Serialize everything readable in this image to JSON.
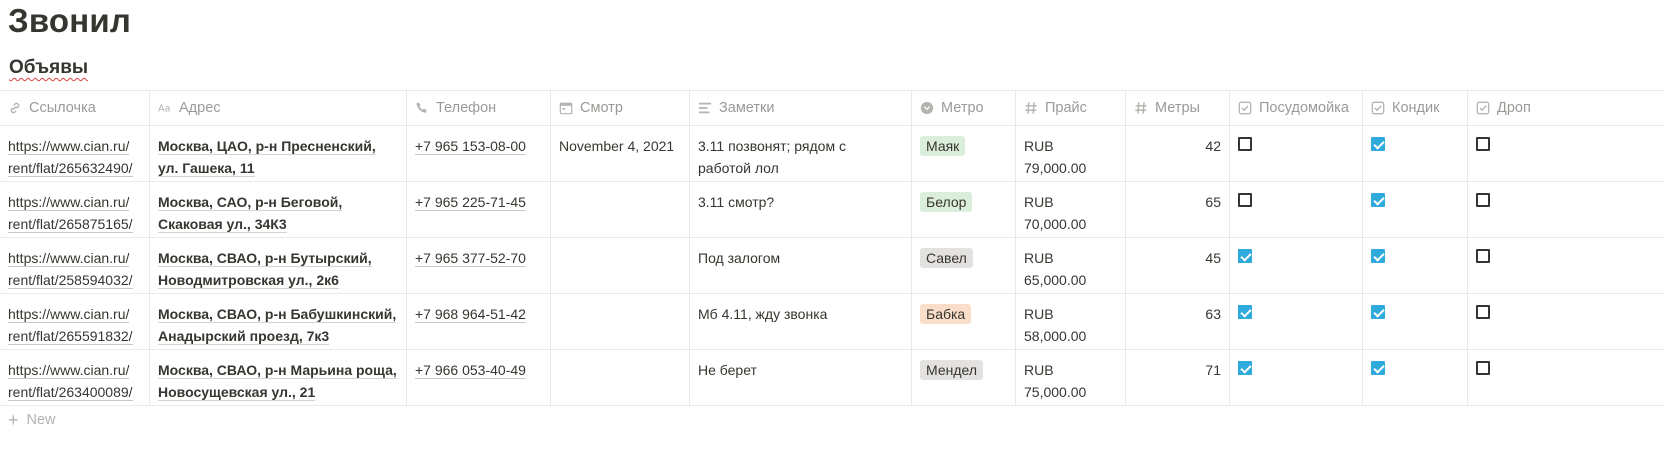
{
  "page": {
    "title": "Звонил",
    "view_name": "Объявы"
  },
  "columns": [
    {
      "key": "link",
      "label": "Ссылочка",
      "icon": "link-icon"
    },
    {
      "key": "address",
      "label": "Адрес",
      "icon": "text-icon"
    },
    {
      "key": "phone",
      "label": "Телефон",
      "icon": "phone-icon"
    },
    {
      "key": "viewing",
      "label": "Смотр",
      "icon": "calendar-icon"
    },
    {
      "key": "notes",
      "label": "Заметки",
      "icon": "lines-icon"
    },
    {
      "key": "metro",
      "label": "Метро",
      "icon": "select-icon"
    },
    {
      "key": "price",
      "label": "Прайс",
      "icon": "hash-icon"
    },
    {
      "key": "meters",
      "label": "Метры",
      "icon": "hash-icon"
    },
    {
      "key": "dishwasher",
      "label": "Посудомойка",
      "icon": "checkbox-icon"
    },
    {
      "key": "ac",
      "label": "Кондик",
      "icon": "checkbox-icon"
    },
    {
      "key": "drop",
      "label": "Дроп",
      "icon": "checkbox-icon"
    }
  ],
  "rows": [
    {
      "link_l1": "https://www.cian.ru/",
      "link_l2": "rent/flat/265632490/",
      "addr_l1": "Москва, ЦАО, р-н Пресненский,",
      "addr_l2": "ул. Гашека, 11",
      "phone": "+7 965 153-08-00",
      "viewing": "November 4, 2021",
      "notes_l1": "3.11 позвонят; рядом с",
      "notes_l2": "работой лол",
      "metro": "Маяк",
      "metro_color": "#dbeddb",
      "price": "RUB 79,000.00",
      "meters": "42",
      "dishwasher": false,
      "ac": true,
      "drop": false
    },
    {
      "link_l1": "https://www.cian.ru/",
      "link_l2": "rent/flat/265875165/",
      "addr_l1": "Москва, САО, р-н Беговой,",
      "addr_l2": "Скаковая ул., 34К3",
      "phone": "+7 965 225-71-45",
      "viewing": "",
      "notes_l1": "3.11 смотр?",
      "notes_l2": "",
      "metro": "Белор",
      "metro_color": "#dbeddb",
      "price": "RUB 70,000.00",
      "meters": "65",
      "dishwasher": false,
      "ac": true,
      "drop": false
    },
    {
      "link_l1": "https://www.cian.ru/",
      "link_l2": "rent/flat/258594032/",
      "addr_l1": "Москва, СВАО, р-н Бутырский,",
      "addr_l2": "Новодмитровская ул., 2к6",
      "phone": "+7 965 377-52-70",
      "viewing": "",
      "notes_l1": "Под залогом",
      "notes_l2": "",
      "metro": "Савел",
      "metro_color": "#e3e2e0",
      "price": "RUB 65,000.00",
      "meters": "45",
      "dishwasher": true,
      "ac": true,
      "drop": false
    },
    {
      "link_l1": "https://www.cian.ru/",
      "link_l2": "rent/flat/265591832/",
      "addr_l1": "Москва, СВАО, р-н Бабушкинский,",
      "addr_l2": "Анадырский проезд, 7к3",
      "phone": "+7 968 964-51-42",
      "viewing": "",
      "notes_l1": "Мб 4.11, жду звонка",
      "notes_l2": "",
      "metro": "Бабка",
      "metro_color": "#fadec9",
      "price": "RUB 58,000.00",
      "meters": "63",
      "dishwasher": true,
      "ac": true,
      "drop": false
    },
    {
      "link_l1": "https://www.cian.ru/",
      "link_l2": "rent/flat/263400089/",
      "addr_l1": "Москва, СВАО, р-н Марьина роща,",
      "addr_l2": "Новосущевская ул., 21",
      "phone": "+7 966 053-40-49",
      "viewing": "",
      "notes_l1": "Не берет",
      "notes_l2": "",
      "metro": "Мендел",
      "metro_color": "#e3e2e0",
      "price": "RUB 75,000.00",
      "meters": "71",
      "dishwasher": true,
      "ac": true,
      "drop": false
    }
  ],
  "footer": {
    "new_label": "New"
  }
}
